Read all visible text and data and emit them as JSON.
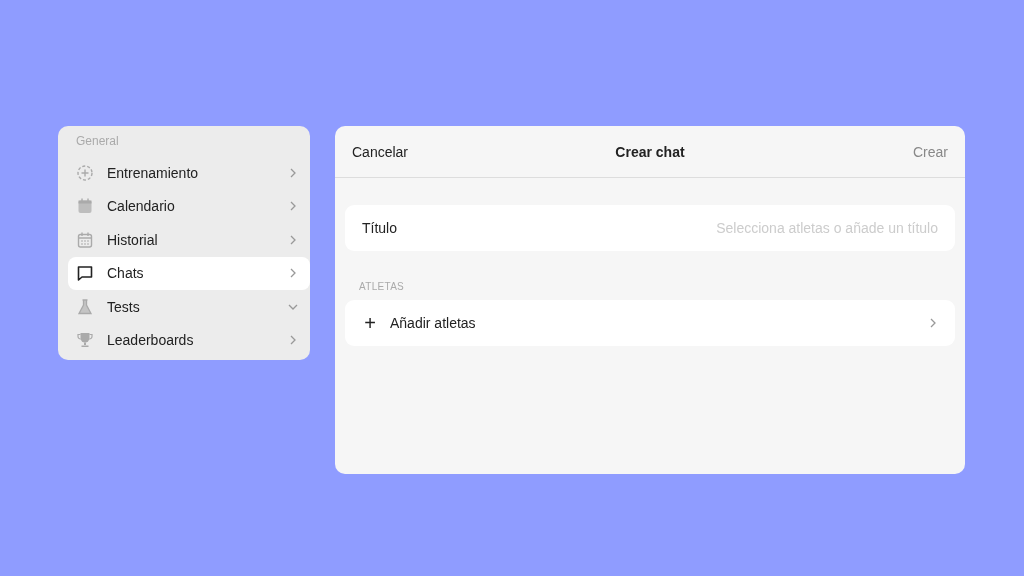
{
  "sidebar": {
    "header": "General",
    "items": [
      {
        "label": "Entrenamiento",
        "selected": false,
        "expanded": false
      },
      {
        "label": "Calendario",
        "selected": false,
        "expanded": false
      },
      {
        "label": "Historial",
        "selected": false,
        "expanded": false
      },
      {
        "label": "Chats",
        "selected": true,
        "expanded": false
      },
      {
        "label": "Tests",
        "selected": false,
        "expanded": true
      },
      {
        "label": "Leaderboards",
        "selected": false,
        "expanded": false
      }
    ]
  },
  "dialog": {
    "cancel": "Cancelar",
    "title": "Crear chat",
    "create": "Crear",
    "create_disabled": true,
    "title_field": {
      "label": "Título",
      "placeholder": "Selecciona atletas o añade un título"
    },
    "section": "ATLETAS",
    "add_row": {
      "icon": "+",
      "label": "Añadir atletas"
    }
  }
}
